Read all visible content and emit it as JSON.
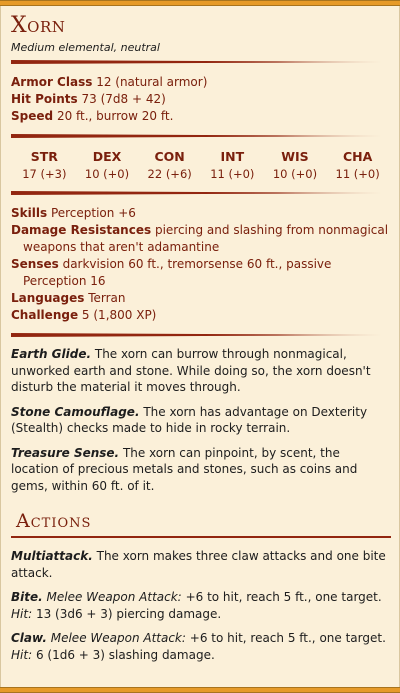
{
  "creature": {
    "name": "Xorn",
    "meta": "Medium elemental, neutral"
  },
  "basics": {
    "ac_label": "Armor Class",
    "ac_value": "12 (natural armor)",
    "hp_label": "Hit Points",
    "hp_value": "73 (7d8 + 42)",
    "speed_label": "Speed",
    "speed_value": "20 ft., burrow 20 ft."
  },
  "abilities": [
    {
      "key": "STR",
      "value": "17 (+3)"
    },
    {
      "key": "DEX",
      "value": "10 (+0)"
    },
    {
      "key": "CON",
      "value": "22 (+6)"
    },
    {
      "key": "INT",
      "value": "11 (+0)"
    },
    {
      "key": "WIS",
      "value": "10 (+0)"
    },
    {
      "key": "CHA",
      "value": "11 (+0)"
    }
  ],
  "details": {
    "skills_label": "Skills",
    "skills_value": "Perception +6",
    "resist_label": "Damage Resistances",
    "resist_value": "piercing and slashing from nonmagical weapons that aren't adamantine",
    "senses_label": "Senses",
    "senses_value": "darkvision 60 ft., tremorsense 60 ft., passive Perception 16",
    "lang_label": "Languages",
    "lang_value": "Terran",
    "challenge_label": "Challenge",
    "challenge_value": "5 (1,800 XP)"
  },
  "traits": [
    {
      "name": "Earth Glide.",
      "text": "The xorn can burrow through nonmagical, unworked earth and stone. While doing so, the xorn doesn't disturb the material it moves through."
    },
    {
      "name": "Stone Camouflage.",
      "text": "The xorn has advantage on Dexterity (Stealth) checks made to hide in rocky terrain."
    },
    {
      "name": "Treasure Sense.",
      "text": "The xorn can pinpoint, by scent, the location of precious metals and stones, such as coins and gems, within 60 ft. of it."
    }
  ],
  "actions_title": "Actions",
  "actions": {
    "multi": {
      "name": "Multiattack.",
      "text": "The xorn makes three claw attacks and one bite attack."
    },
    "bite": {
      "name": "Bite.",
      "type": "Melee Weapon Attack:",
      "text1": "+6 to hit, reach 5 ft., one target.",
      "hit": "Hit:",
      "text2": "13 (3d6 + 3) piercing damage."
    },
    "claw": {
      "name": "Claw.",
      "type": "Melee Weapon Attack:",
      "text1": "+6 to hit, reach 5 ft., one target.",
      "hit": "Hit:",
      "text2": "6 (1d6 + 3) slashing damage."
    }
  }
}
